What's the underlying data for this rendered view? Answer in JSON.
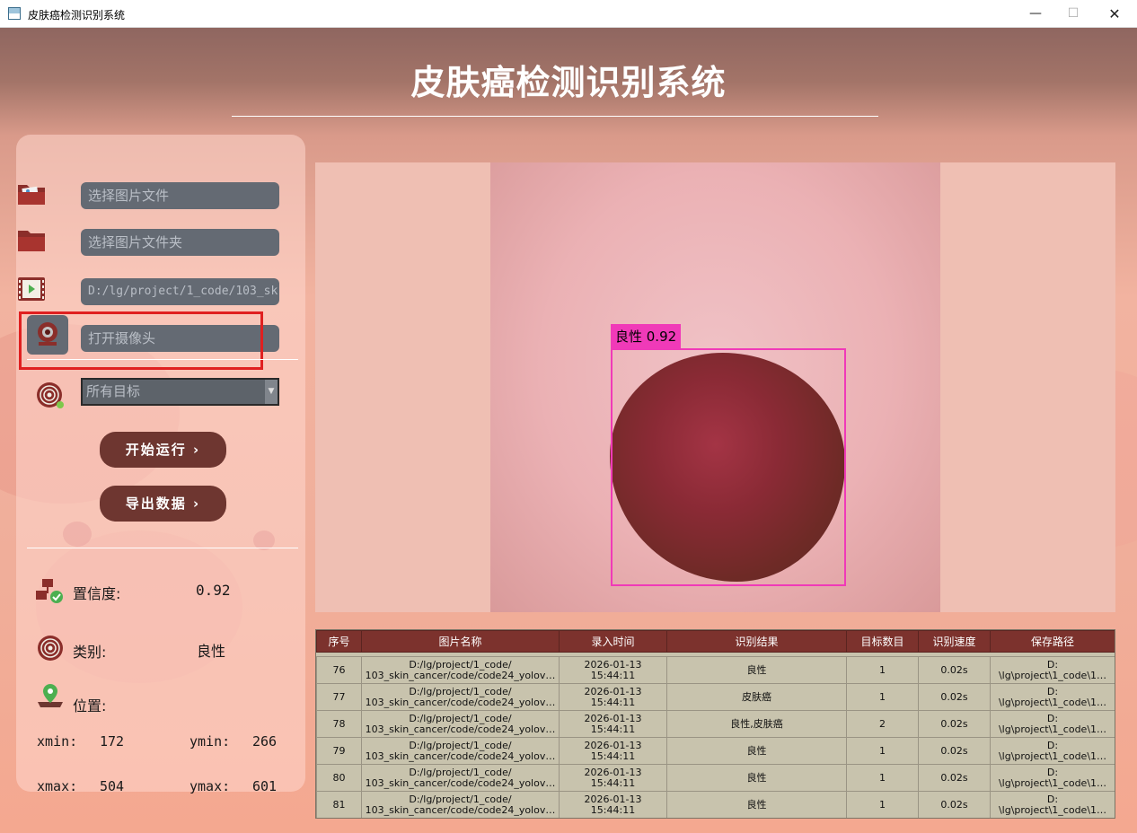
{
  "window": {
    "title": "皮肤癌检测识别系统",
    "minimize": "—",
    "maximize": "☐",
    "close": "✕"
  },
  "header": {
    "title": "皮肤癌检测识别系统"
  },
  "sources": {
    "image_file_placeholder": "选择图片文件",
    "image_folder_placeholder": "选择图片文件夹",
    "video_path": "D:/lg/project/1_code/103_sk",
    "camera_placeholder": "打开摄像头"
  },
  "target_select": {
    "selected": "所有目标"
  },
  "buttons": {
    "start": "开始运行 ›",
    "export": "导出数据 ›"
  },
  "stats": {
    "confidence_label": "置信度:",
    "confidence_value": "0.92",
    "class_label": "类别:",
    "class_value": "良性",
    "position_label": "位置:",
    "xmin_label": "xmin:",
    "xmin": "172",
    "ymin_label": "ymin:",
    "ymin": "266",
    "xmax_label": "xmax:",
    "xmax": "504",
    "ymax_label": "ymax:",
    "ymax": "601"
  },
  "detection": {
    "label": "良性 0.92",
    "box_color": "#f03ab8"
  },
  "table": {
    "columns": [
      "序号",
      "图片名称",
      "录入时间",
      "识别结果",
      "目标数目",
      "识别速度",
      "保存路径"
    ],
    "rows": [
      {
        "id": "76",
        "name1": "D:/lg/project/1_code/",
        "name2": "103_skin_cancer/code/code24_yolov…",
        "time1": "2026-01-13",
        "time2": "15:44:11",
        "result": "良性",
        "count": "1",
        "speed": "0.02s",
        "path1": "D:",
        "path2": "\\lg\\project\\1_code\\1…"
      },
      {
        "id": "77",
        "name1": "D:/lg/project/1_code/",
        "name2": "103_skin_cancer/code/code24_yolov…",
        "time1": "2026-01-13",
        "time2": "15:44:11",
        "result": "皮肤癌",
        "count": "1",
        "speed": "0.02s",
        "path1": "D:",
        "path2": "\\lg\\project\\1_code\\1…"
      },
      {
        "id": "78",
        "name1": "D:/lg/project/1_code/",
        "name2": "103_skin_cancer/code/code24_yolov…",
        "time1": "2026-01-13",
        "time2": "15:44:11",
        "result": "良性,皮肤癌",
        "count": "2",
        "speed": "0.02s",
        "path1": "D:",
        "path2": "\\lg\\project\\1_code\\1…"
      },
      {
        "id": "79",
        "name1": "D:/lg/project/1_code/",
        "name2": "103_skin_cancer/code/code24_yolov…",
        "time1": "2026-01-13",
        "time2": "15:44:11",
        "result": "良性",
        "count": "1",
        "speed": "0.02s",
        "path1": "D:",
        "path2": "\\lg\\project\\1_code\\1…"
      },
      {
        "id": "80",
        "name1": "D:/lg/project/1_code/",
        "name2": "103_skin_cancer/code/code24_yolov…",
        "time1": "2026-01-13",
        "time2": "15:44:11",
        "result": "良性",
        "count": "1",
        "speed": "0.02s",
        "path1": "D:",
        "path2": "\\lg\\project\\1_code\\1…"
      },
      {
        "id": "81",
        "name1": "D:/lg/project/1_code/",
        "name2": "103_skin_cancer/code/code24_yolov…",
        "time1": "2026-01-13",
        "time2": "15:44:11",
        "result": "良性",
        "count": "1",
        "speed": "0.02s",
        "path1": "D:",
        "path2": "\\lg\\project\\1_code\\1…"
      }
    ]
  },
  "colors": {
    "accent": "#6e3630",
    "table_header": "#7c322d",
    "field_bg": "#646a73"
  },
  "icons": [
    "image-folder-icon",
    "folder-icon",
    "video-file-icon",
    "webcam-icon",
    "target-icon",
    "confidence-icon",
    "class-icon",
    "location-pin-icon"
  ]
}
